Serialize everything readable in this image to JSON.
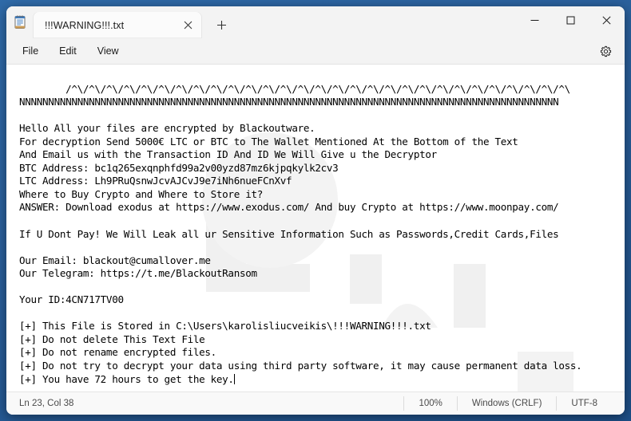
{
  "window": {
    "app_name": "Notepad",
    "app_icon": "notepad-icon"
  },
  "tabs": [
    {
      "label": "!!!WARNING!!!.txt",
      "close_icon": "close-icon",
      "active": true
    }
  ],
  "new_tab": {
    "icon": "plus-icon",
    "label": "+"
  },
  "caption": {
    "minimize": {
      "icon": "minimize-icon",
      "glyph": "─"
    },
    "maximize": {
      "icon": "maximize-icon",
      "glyph": "□"
    },
    "close": {
      "icon": "close-icon",
      "glyph": "✕"
    }
  },
  "menubar": {
    "items": [
      {
        "label": "File"
      },
      {
        "label": "Edit"
      },
      {
        "label": "View"
      }
    ],
    "settings": {
      "icon": "gear-icon",
      "label": "Settings"
    }
  },
  "document": {
    "lines": [
      "/^\\/^\\/^\\/^\\/^\\/^\\/^\\/^\\/^\\/^\\/^\\/^\\/^\\/^\\/^\\/^\\/^\\/^\\/^\\/^\\/^\\/^\\/^\\/^\\/^\\/^\\/^\\/^\\/^\\",
      "NNNNNNNNNNNNNNNNNNNNNNNNNNNNNNNNNNNNNNNNNNNNNNNNNNNNNNNNNNNNNNNNNNNNNNNNNNNNNNNNNNNNNNNNNNNNN",
      "",
      "Hello All your files are encrypted by Blackoutware.",
      "For decryption Send 5000€ LTC or BTC to The Wallet Mentioned At the Bottom of the Text",
      "And Email us with the Transaction ID And ID We Will Give u the Decryptor",
      "BTC Address: bc1q265exqnphfd99a2v00yzd87mz6kjpqkylk2cv3",
      "LTC Address: Lh9PRuQsnwJcvAJCvJ9e7iNh6nueFCnXvf",
      "Where to Buy Crypto and Where to Store it?",
      "ANSWER: Download exodus at https://www.exodus.com/ And buy Crypto at https://www.moonpay.com/",
      "",
      "If U Dont Pay! We Will Leak all ur Sensitive Information Such as Passwords,Credit Cards,Files",
      "",
      "Our Email: blackout@cumallover.me",
      "Our Telegram: https://t.me/BlackoutRansom",
      "",
      "Your ID:4CN717TV00",
      "",
      "[+] This File is Stored in C:\\Users\\karolisliucveikis\\!!!WARNING!!!.txt",
      "[+] Do not delete This Text File",
      "[+] Do not rename encrypted files.",
      "[+] Do not try to decrypt your data using third party software, it may cause permanent data loss.",
      "[+] You have 72 hours to get the key."
    ]
  },
  "statusbar": {
    "position": "Ln 23, Col 38",
    "zoom": "100%",
    "line_ending": "Windows (CRLF)",
    "encoding": "UTF-8"
  },
  "colors": {
    "desktop": "#2a5f9b",
    "window_chrome": "#f3f3f3",
    "editor_bg": "#ffffff",
    "text": "#000000",
    "close_hover": "#c42b1c"
  }
}
